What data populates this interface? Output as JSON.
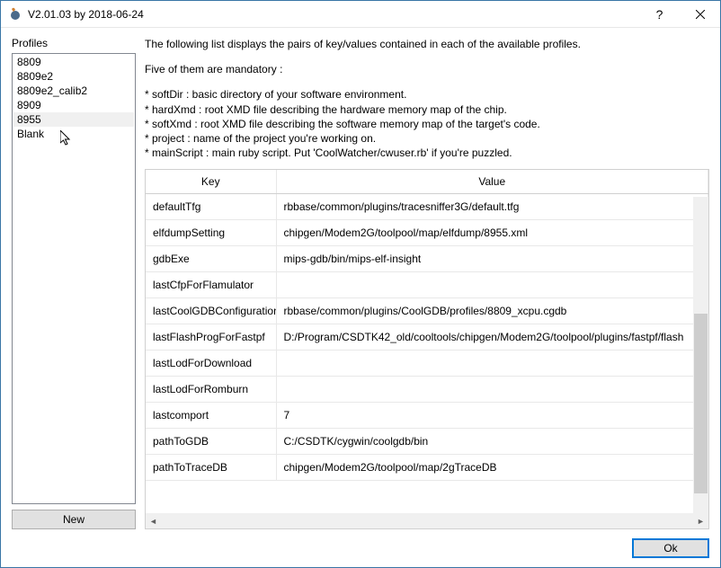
{
  "window": {
    "title": "V2.01.03 by 2018-06-24"
  },
  "left": {
    "group_label": "Profiles",
    "items": [
      "8809",
      "8809e2",
      "8809e2_calib2",
      "8909",
      "8955",
      "Blank"
    ],
    "selected_index": 4,
    "new_button": "New"
  },
  "description": {
    "intro": "The following list displays the pairs of key/values contained in each of the available profiles.",
    "mandatory_heading": "Five of them are mandatory :",
    "bullets": [
      "* softDir : basic directory of your software environment.",
      "* hardXmd : root XMD file describing the hardware memory map of the chip.",
      "* softXmd : root XMD file describing the software memory map of the target's code.",
      "* project : name of the project you're working on.",
      "* mainScript : main ruby script. Put 'CoolWatcher/cwuser.rb' if you're puzzled."
    ]
  },
  "table": {
    "headers": {
      "key": "Key",
      "value": "Value"
    },
    "rows": [
      {
        "key": "defaultTfg",
        "value": "rbbase/common/plugins/tracesniffer3G/default.tfg"
      },
      {
        "key": "elfdumpSetting",
        "value": "chipgen/Modem2G/toolpool/map/elfdump/8955.xml"
      },
      {
        "key": "gdbExe",
        "value": "mips-gdb/bin/mips-elf-insight"
      },
      {
        "key": "lastCfpForFlamulator",
        "value": ""
      },
      {
        "key": "lastCoolGDBConfiguration",
        "value": "rbbase/common/plugins/CoolGDB/profiles/8809_xcpu.cgdb"
      },
      {
        "key": "lastFlashProgForFastpf",
        "value": "D:/Program/CSDTK42_old/cooltools/chipgen/Modem2G/toolpool/plugins/fastpf/flash"
      },
      {
        "key": "lastLodForDownload",
        "value": ""
      },
      {
        "key": "lastLodForRomburn",
        "value": ""
      },
      {
        "key": "lastcomport",
        "value": "7"
      },
      {
        "key": "pathToGDB",
        "value": "C:/CSDTK/cygwin/coolgdb/bin"
      },
      {
        "key": "pathToTraceDB",
        "value": "chipgen/Modem2G/toolpool/map/2gTraceDB"
      }
    ]
  },
  "buttons": {
    "ok": "Ok"
  }
}
